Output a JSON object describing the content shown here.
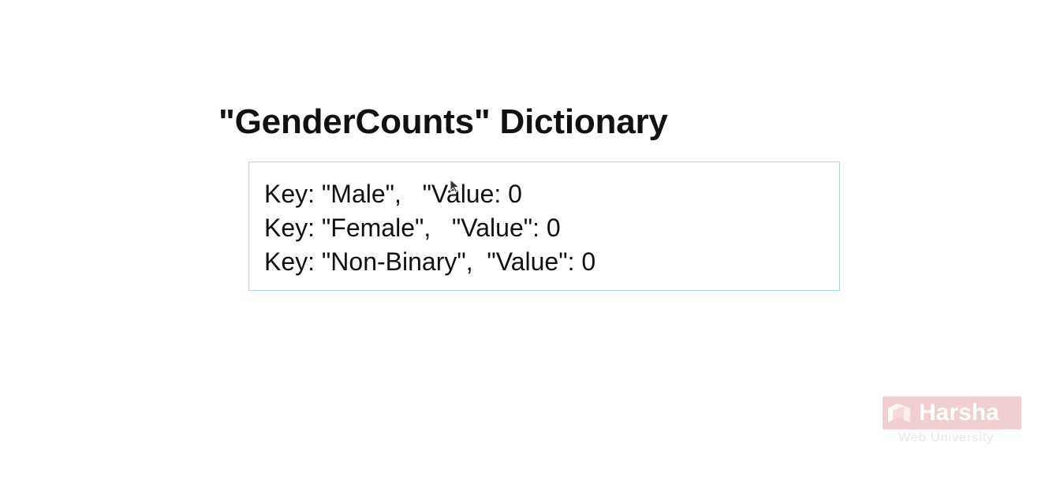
{
  "slide": {
    "title": "\"GenderCounts\" Dictionary",
    "lines": [
      "Key: \"Male\",   \"Value: 0",
      "Key: \"Female\",   \"Value\": 0",
      "Key: \"Non-Binary\",  \"Value\": 0"
    ]
  },
  "watermark": {
    "name": "Harsha",
    "subtitle": "Web University"
  },
  "colors": {
    "box_border": "#a9d7f0",
    "text": "#111111",
    "watermark_badge": "#d8797b"
  },
  "icons": {
    "cursor": "mouse-pointer-icon",
    "logo": "harsha-logo-icon"
  }
}
